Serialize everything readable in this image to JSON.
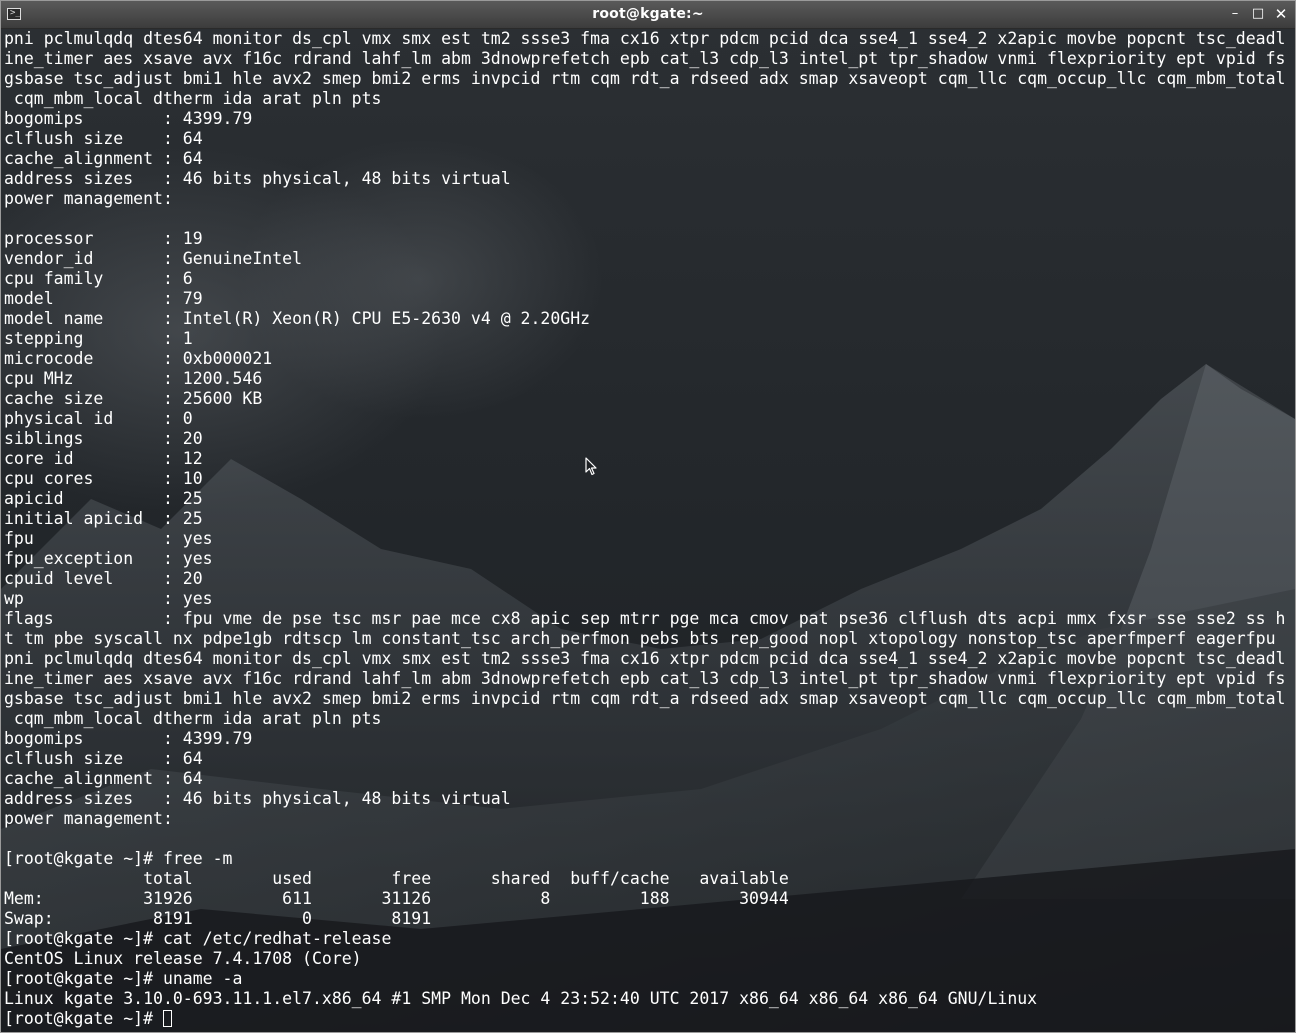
{
  "window": {
    "title": "root@kgate:~",
    "icon_name": "terminal-icon",
    "minimize_glyph": "–",
    "maximize_glyph": "□",
    "close_glyph": "✕"
  },
  "terminal": {
    "lines": [
      "pni pclmulqdq dtes64 monitor ds_cpl vmx smx est tm2 ssse3 fma cx16 xtpr pdcm pcid dca sse4_1 sse4_2 x2apic movbe popcnt tsc_deadl",
      "ine_timer aes xsave avx f16c rdrand lahf_lm abm 3dnowprefetch epb cat_l3 cdp_l3 intel_pt tpr_shadow vnmi flexpriority ept vpid fs",
      "gsbase tsc_adjust bmi1 hle avx2 smep bmi2 erms invpcid rtm cqm rdt_a rdseed adx smap xsaveopt cqm_llc cqm_occup_llc cqm_mbm_total",
      " cqm_mbm_local dtherm ida arat pln pts",
      "bogomips        : 4399.79",
      "clflush size    : 64",
      "cache_alignment : 64",
      "address sizes   : 46 bits physical, 48 bits virtual",
      "power management:",
      "",
      "processor       : 19",
      "vendor_id       : GenuineIntel",
      "cpu family      : 6",
      "model           : 79",
      "model name      : Intel(R) Xeon(R) CPU E5-2630 v4 @ 2.20GHz",
      "stepping        : 1",
      "microcode       : 0xb000021",
      "cpu MHz         : 1200.546",
      "cache size      : 25600 KB",
      "physical id     : 0",
      "siblings        : 20",
      "core id         : 12",
      "cpu cores       : 10",
      "apicid          : 25",
      "initial apicid  : 25",
      "fpu             : yes",
      "fpu_exception   : yes",
      "cpuid level     : 20",
      "wp              : yes",
      "flags           : fpu vme de pse tsc msr pae mce cx8 apic sep mtrr pge mca cmov pat pse36 clflush dts acpi mmx fxsr sse sse2 ss h",
      "t tm pbe syscall nx pdpe1gb rdtscp lm constant_tsc arch_perfmon pebs bts rep_good nopl xtopology nonstop_tsc aperfmperf eagerfpu",
      "pni pclmulqdq dtes64 monitor ds_cpl vmx smx est tm2 ssse3 fma cx16 xtpr pdcm pcid dca sse4_1 sse4_2 x2apic movbe popcnt tsc_deadl",
      "ine_timer aes xsave avx f16c rdrand lahf_lm abm 3dnowprefetch epb cat_l3 cdp_l3 intel_pt tpr_shadow vnmi flexpriority ept vpid fs",
      "gsbase tsc_adjust bmi1 hle avx2 smep bmi2 erms invpcid rtm cqm rdt_a rdseed adx smap xsaveopt cqm_llc cqm_occup_llc cqm_mbm_total",
      " cqm_mbm_local dtherm ida arat pln pts",
      "bogomips        : 4399.79",
      "clflush size    : 64",
      "cache_alignment : 64",
      "address sizes   : 46 bits physical, 48 bits virtual",
      "power management:",
      "",
      "[root@kgate ~]# free -m",
      "              total        used        free      shared  buff/cache   available",
      "Mem:          31926         611       31126           8         188       30944",
      "Swap:          8191           0        8191",
      "[root@kgate ~]# cat /etc/redhat-release",
      "CentOS Linux release 7.4.1708 (Core)",
      "[root@kgate ~]# uname -a",
      "Linux kgate 3.10.0-693.11.1.el7.x86_64 #1 SMP Mon Dec 4 23:52:40 UTC 2017 x86_64 x86_64 x86_64 GNU/Linux"
    ],
    "prompt": "[root@kgate ~]# ",
    "text_color": "#ffffff",
    "background_color": "#23272b"
  }
}
